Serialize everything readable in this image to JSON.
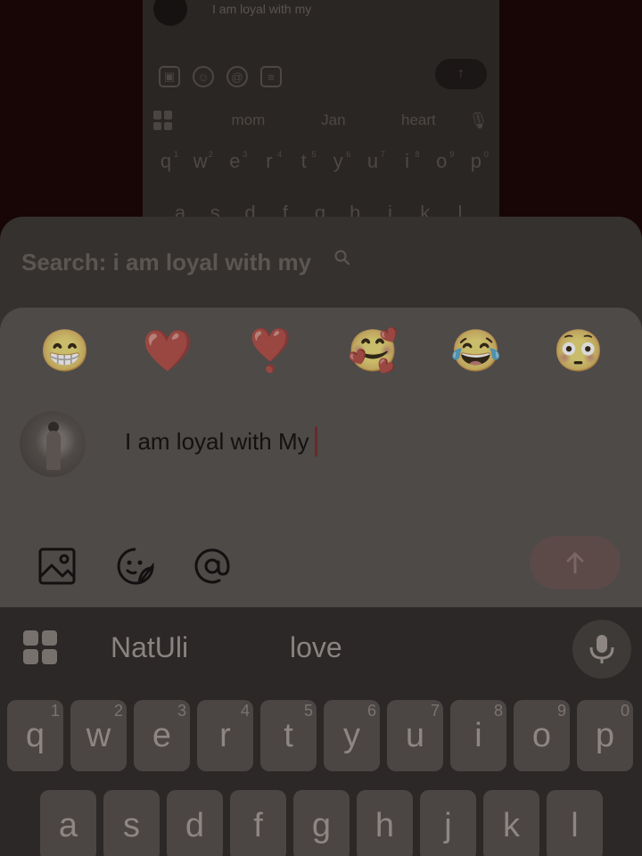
{
  "background_preview": {
    "message_text": "I am loyal with my",
    "toolbar_icons": [
      "image-icon",
      "sticker-icon",
      "at-icon",
      "note-icon"
    ],
    "send_arrow": "↑",
    "suggestions": [
      "mom",
      "Jan",
      "heart"
    ],
    "row1_keys": [
      "q",
      "w",
      "e",
      "r",
      "t",
      "y",
      "u",
      "i",
      "o",
      "p"
    ],
    "row1_hints": [
      "1",
      "2",
      "3",
      "4",
      "5",
      "6",
      "7",
      "8",
      "9",
      "0"
    ],
    "row2_keys": [
      "a",
      "s",
      "d",
      "f",
      "g",
      "h",
      "j",
      "k",
      "l"
    ]
  },
  "search": {
    "text": "Search: i am loyal with my"
  },
  "composer": {
    "emojis": [
      "😁",
      "❤️",
      "❣️",
      "🥰",
      "😂",
      "😳"
    ],
    "input_value": "I am loyal with My",
    "tools": [
      "image-icon",
      "sticker-icon",
      "at-icon"
    ],
    "send_arrow": "↑"
  },
  "keyboard": {
    "suggestions": [
      "NatUli",
      "love"
    ],
    "row1": [
      {
        "key": "q",
        "hint": "1"
      },
      {
        "key": "w",
        "hint": "2"
      },
      {
        "key": "e",
        "hint": "3"
      },
      {
        "key": "r",
        "hint": "4"
      },
      {
        "key": "t",
        "hint": "5"
      },
      {
        "key": "y",
        "hint": "6"
      },
      {
        "key": "u",
        "hint": "7"
      },
      {
        "key": "i",
        "hint": "8"
      },
      {
        "key": "o",
        "hint": "9"
      },
      {
        "key": "p",
        "hint": "0"
      }
    ],
    "row2": [
      "a",
      "s",
      "d",
      "f",
      "g",
      "h",
      "j",
      "k",
      "l"
    ]
  },
  "colors": {
    "caret": "#6a2a2a",
    "send_button": "#5c4a48",
    "composer_bg": "#4d4a48"
  }
}
